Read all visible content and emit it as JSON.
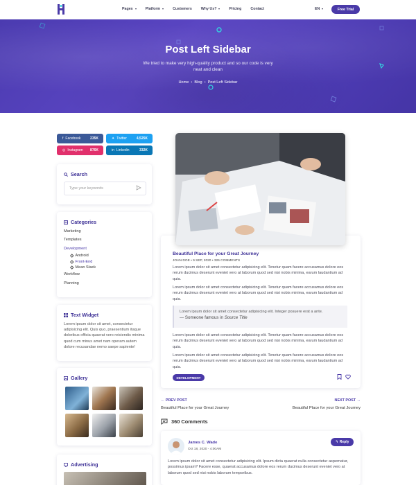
{
  "nav": {
    "menu": [
      {
        "label": "Pages",
        "dropdown": true
      },
      {
        "label": "Platform",
        "dropdown": true
      },
      {
        "label": "Customers",
        "dropdown": false
      },
      {
        "label": "Why Us?",
        "dropdown": true
      },
      {
        "label": "Pricing",
        "dropdown": false
      },
      {
        "label": "Contact",
        "dropdown": false
      }
    ],
    "lang": "EN",
    "cta": "Free Trial"
  },
  "hero": {
    "title": "Post Left Sidebar",
    "subtitle": "We tried to make very high-quality product and so our code is very neat and clean",
    "breadcrumb": [
      "Home",
      "Blog",
      "Post Left Sidebar"
    ]
  },
  "social": [
    {
      "name": "Facebook",
      "count": "235K",
      "color": "#3b5998"
    },
    {
      "name": "Twitter",
      "count": "4,525K",
      "color": "#1da1f2"
    },
    {
      "name": "Instagram",
      "count": "876K",
      "color": "#e1306c"
    },
    {
      "name": "Linkedin",
      "count": "332K",
      "color": "#0a77b5"
    }
  ],
  "search": {
    "title": "Search",
    "placeholder": "Type your keywords"
  },
  "categories": {
    "title": "Categories",
    "items": [
      "Marketing",
      "Templates",
      "Development",
      "Workflow",
      "Planning"
    ],
    "sub_items": [
      "Android",
      "Front-End",
      "Mean Stack"
    ]
  },
  "text_widget": {
    "title": "Text Widget",
    "body": "Lorem ipsum dolor sit amet, consectetur adipisicing elit. Quis quo, praesentium itaque doloribus officia quaerat vero reiciendis minima quod cum minus amet nam operam autem dolore recusandae nemo saepe sapiente!"
  },
  "gallery": {
    "title": "Gallery"
  },
  "advertising": {
    "title": "Advertising"
  },
  "post": {
    "title": "Beautiful Place for your Great Journey",
    "author": "JOHN DOE",
    "date": "9 SEP, 2020",
    "comments": "326 COMMENTS",
    "paragraphs": [
      "Lorem ipsum dolor sit amet consectetur adipisicing elit. Tenetur quam facere accusamus dolore eos rerum ducimus deserunt eveniet vero at laborum quod sed nisi nobis minima, earum laudantium ad quia.",
      "Lorem ipsum dolor sit amet consectetur adipisicing elit. Tenetur quam facere accusamus dolore eos rerum ducimus deserunt eveniet vero at laborum quod sed nisi nobis minima, earum laudantium ad quia.",
      "Lorem ipsum dolor sit amet consectetur adipisicing elit. Tenetur quam facere accusamus dolore eos rerum ducimus deserunt eveniet vero at laborum quod sed nisi nobis minima, earum laudantium ad quia.",
      "Lorem ipsum dolor sit amet consectetur adipisicing elit. Tenetur quam facere accusamus dolore eos rerum ducimus deserunt eveniet vero at laborum quod sed nisi nobis minima, earum laudantium ad quia."
    ],
    "quote_text": "Lorem ipsum dolor sit amet consectetur adipisicing elit. Integer posuere erat a ante.",
    "quote_author": "— Someone famous in",
    "quote_source": "Source Title",
    "tag": "DEVELOPMENT"
  },
  "post_nav": {
    "prev_label": "PREV POST",
    "prev_title": "Beautiful Place for your Great Journey",
    "next_label": "NEXT POST",
    "next_title": "Beautiful Place for your Great Journey"
  },
  "comments": {
    "heading": "360 Comments",
    "first": {
      "name": "James C. Wade",
      "date": "Oct 18, 2020 - 4:00AM",
      "reply": "Reply",
      "text": "Lorem ipsum dolor sit amet consectetur adipisicing elit. Ipsum dicta quaerat nulla consectetur aspernatur, possimus ipsam? Facere esse, quaerat accusamus dolore eos rerum ducimus deserunt eveniet vero at laborum quod sed nisi nobis laborum temporibus."
    }
  },
  "colors": {
    "brand": "#4a3aa8",
    "hero": "#4e3cb6",
    "accent_cyan": "#35d0e0"
  }
}
